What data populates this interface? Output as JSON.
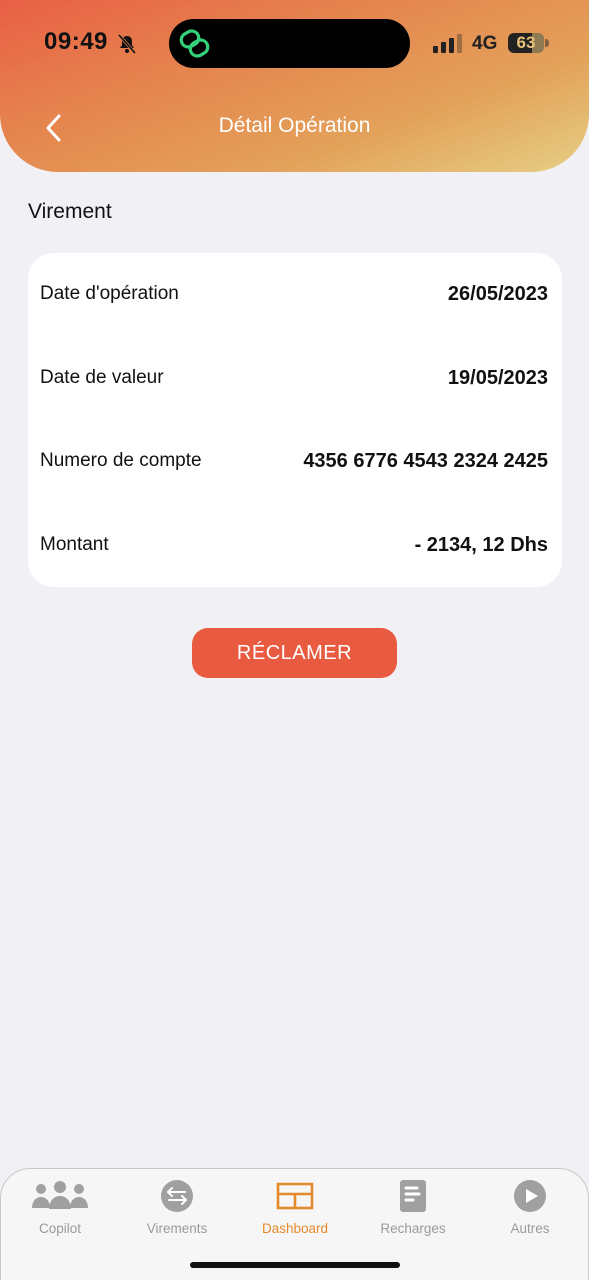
{
  "status_bar": {
    "time": "09:49",
    "network": "4G",
    "battery": "63"
  },
  "header": {
    "title": "Détail Opération"
  },
  "section": {
    "label": "Virement"
  },
  "details": [
    {
      "label": "Date d'opération",
      "value": "26/05/2023"
    },
    {
      "label": "Date de valeur",
      "value": "19/05/2023"
    },
    {
      "label": "Numero de compte",
      "value": "4356 6776 4543 2324 2425"
    },
    {
      "label": "Montant",
      "value": "- 2134, 12 Dhs"
    }
  ],
  "actions": {
    "reclamer_label": "RÉCLAMER"
  },
  "tabbar": {
    "items": [
      {
        "label": "Copilot",
        "icon": "people-icon"
      },
      {
        "label": "Virements",
        "icon": "transfer-icon"
      },
      {
        "label": "Dashboard",
        "icon": "dashboard-icon",
        "active": true
      },
      {
        "label": "Recharges",
        "icon": "document-icon"
      },
      {
        "label": "Autres",
        "icon": "play-icon"
      }
    ]
  },
  "colors": {
    "accent": "#e85b40",
    "active_tab": "#e58a2b",
    "inactive_tab": "#9a9a9a",
    "background": "#f1f0f5"
  }
}
